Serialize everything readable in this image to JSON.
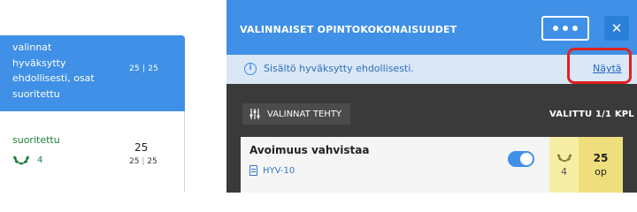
{
  "left_list": {
    "items": [
      {
        "status_lines": [
          "valinnat",
          "hyväksytty",
          "ehdollisesti, osat",
          "suoritettu"
        ],
        "credits": "25 | 25"
      },
      {
        "status": "suoritettu",
        "grade": "4",
        "credits_big": "25",
        "credits_done": "25",
        "credits_total": "25"
      }
    ]
  },
  "panel": {
    "title": "VALINNAISET OPINTOKOKONAISUUDET",
    "more_label": "•••",
    "close_label": "✕",
    "info": {
      "text": "Sisältö hyväksytty ehdollisesti.",
      "link": "Näytä"
    },
    "filter_label": "VALINNAT TEHTY",
    "selected_label": "VALITTU 1/1 KPL",
    "course": {
      "name": "Avoimuus vahvistaa",
      "code": "HYV-10",
      "grade": "4",
      "credits": "25",
      "credit_unit": "op",
      "toggle_on": true
    }
  },
  "colors": {
    "brand_blue": "#3f90e6",
    "panel_dark": "#3a3a3a",
    "info_bg": "#d9e7f6",
    "success_green": "#1f7f3c",
    "grade_yellow": "#f7eea5",
    "credit_yellow": "#efdf7c",
    "highlight_red": "#e02020"
  },
  "icons": {
    "info": "info-circle-icon",
    "filter": "sliders-icon",
    "document": "document-icon",
    "laurel": "laurel-icon",
    "more": "more-dots-icon",
    "close": "close-icon"
  }
}
